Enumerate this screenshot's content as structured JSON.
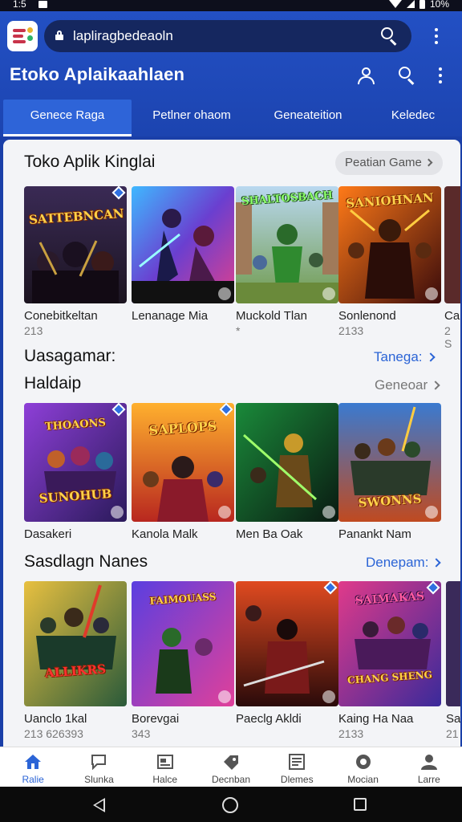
{
  "status_bar": {
    "time": "1:5",
    "battery": "10%"
  },
  "header": {
    "search_placeholder": "lapliragbedeaoln",
    "app_title": "Etoko Aplaikaahlaen",
    "icons": [
      "app-logo",
      "lock-icon",
      "search-icon",
      "more-vert-icon",
      "account-icon",
      "search-icon",
      "more-vert-icon"
    ]
  },
  "tabs": [
    {
      "label": "Genece Raga",
      "active": true
    },
    {
      "label": "Petlner ohaom",
      "active": false
    },
    {
      "label": "Geneateition",
      "active": false
    },
    {
      "label": "Keledec",
      "active": false
    }
  ],
  "sections": [
    {
      "title": "Toko Aplik Kinglai",
      "link": "Peatian Game",
      "items": [
        {
          "name": "Conebitkeltan",
          "meta": "213",
          "art": "SATTEBNCAN"
        },
        {
          "name": "Lenanage Mia",
          "meta": "",
          "art": ""
        },
        {
          "name": "Muckold Tlan",
          "meta": "*",
          "art": "SHALTOSBACH"
        },
        {
          "name": "Sonlenond",
          "meta": "2133",
          "art": "SANIOHNAN"
        },
        {
          "name": "Ca",
          "meta": "2 S",
          "art": ""
        }
      ]
    },
    {
      "title": "Uasagamar:",
      "link": "Tanega:",
      "items": []
    },
    {
      "title": "Haldaip",
      "link": "Geneoar",
      "items": [
        {
          "name": "Dasakeri",
          "meta": "",
          "art": "THOAONS",
          "art2": "SUNOHUB"
        },
        {
          "name": "Kanola Malk",
          "meta": "",
          "art": "SAPLOPS"
        },
        {
          "name": "Men Ba Oak",
          "meta": "",
          "art": ""
        },
        {
          "name": "Panankt Nam",
          "meta": "",
          "art2": "SWONNS"
        }
      ]
    },
    {
      "title": "Sasdlagn Nanes",
      "link": "Denepam:",
      "items": [
        {
          "name": "Uanclo 1kal",
          "meta": "213 626393",
          "art2": "ALLIKRS"
        },
        {
          "name": "Borevgai",
          "meta": "343",
          "art": "FAIMOUASS"
        },
        {
          "name": "Paeclg Akldi",
          "meta": "",
          "art": ""
        },
        {
          "name": "Kaing Ha Naa",
          "meta": "2133",
          "art": "SAIMAKAS",
          "art2": "CHANG SHENG"
        },
        {
          "name": "Sa",
          "meta": "21",
          "art": ""
        }
      ]
    }
  ],
  "bottom_nav": [
    {
      "label": "Ralie",
      "icon": "home-icon",
      "active": true
    },
    {
      "label": "Slunka",
      "icon": "chat-icon",
      "active": false
    },
    {
      "label": "Halce",
      "icon": "news-icon",
      "active": false
    },
    {
      "label": "Decnban",
      "icon": "tag-icon",
      "active": false
    },
    {
      "label": "Dlemes",
      "icon": "list-icon",
      "active": false
    },
    {
      "label": "Mocian",
      "icon": "badge-icon",
      "active": false
    },
    {
      "label": "Larre",
      "icon": "profile-icon",
      "active": false
    }
  ],
  "colors": {
    "header": "#2350c4",
    "accent": "#2b64d6",
    "content_bg": "#f3f4f7"
  }
}
